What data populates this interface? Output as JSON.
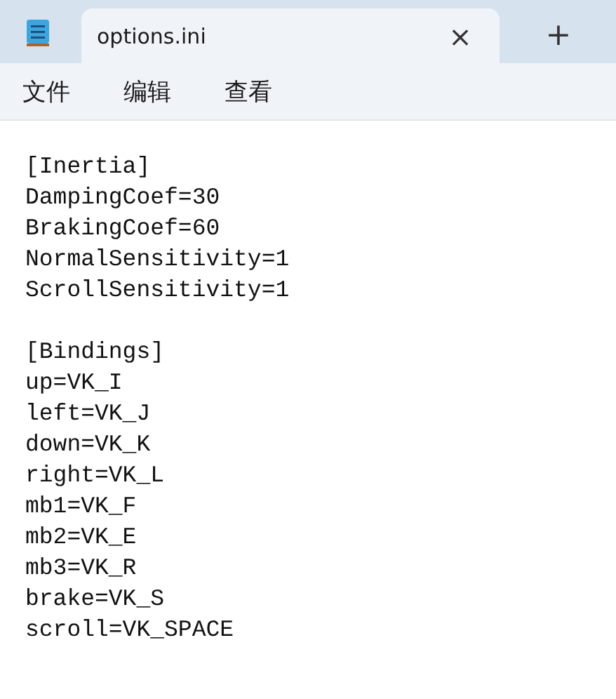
{
  "tab": {
    "title": "options.ini",
    "close": "×"
  },
  "new_tab": "+",
  "menu": [
    "文件",
    "编辑",
    "查看"
  ],
  "editor": {
    "blocks": [
      [
        "[Inertia]",
        "DampingCoef=30",
        "BrakingCoef=60",
        "NormalSensitivity=1",
        "ScrollSensitivity=1"
      ],
      [
        "[Bindings]",
        "up=VK_I",
        "left=VK_J",
        "down=VK_K",
        "right=VK_L",
        "mb1=VK_F",
        "mb2=VK_E",
        "mb3=VK_R",
        "brake=VK_S",
        "scroll=VK_SPACE"
      ]
    ]
  }
}
